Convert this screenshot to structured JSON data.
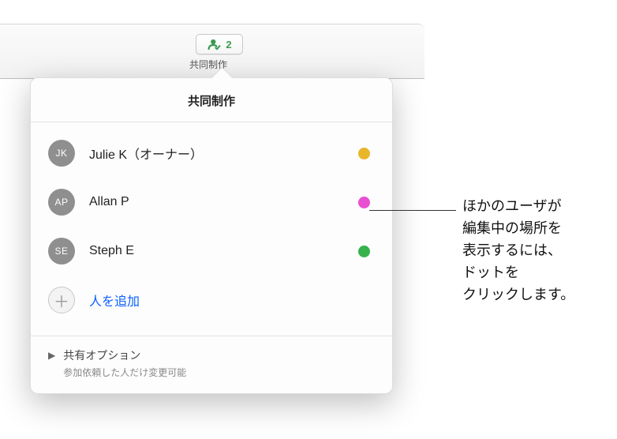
{
  "toolbar": {
    "collab_count": "2",
    "collab_label": "共同制作"
  },
  "popover": {
    "title": "共同制作",
    "participants": [
      {
        "initials": "JK",
        "name": "Julie K（オーナー）",
        "avatar_color": "#8f8f8f",
        "dot_color": "#e8b62b"
      },
      {
        "initials": "AP",
        "name": "Allan P",
        "avatar_color": "#8f8f8f",
        "dot_color": "#e84fd1"
      },
      {
        "initials": "SE",
        "name": "Steph E",
        "avatar_color": "#8f8f8f",
        "dot_color": "#37b24d"
      }
    ],
    "add_person_label": "人を追加",
    "share_options": {
      "title": "共有オプション",
      "subtitle": "参加依頼した人だけ変更可能"
    }
  },
  "callout": {
    "text": "ほかのユーザが\n編集中の場所を\n表示するには、\nドットを\nクリックします。"
  },
  "colors": {
    "person_icon": "#3a9b4f",
    "link_blue": "#0a60ff"
  }
}
